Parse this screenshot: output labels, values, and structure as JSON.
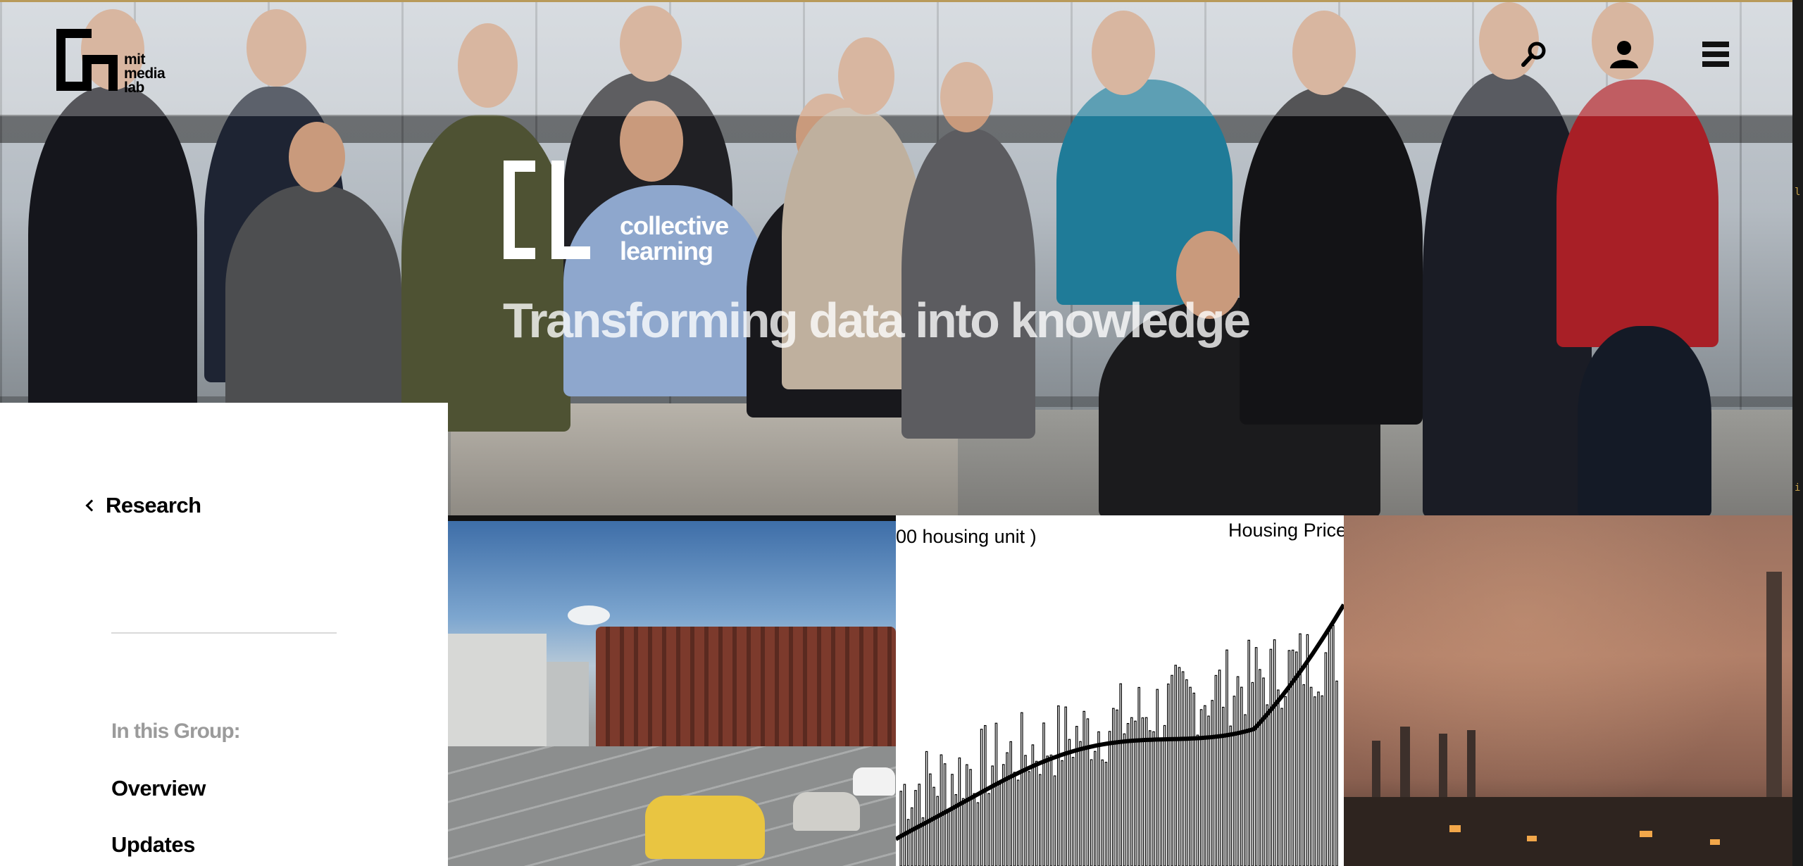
{
  "header": {
    "logo_line1": "mit",
    "logo_line2": "media",
    "logo_line3": "lab",
    "icons": [
      "search-icon",
      "user-icon",
      "menu-icon"
    ]
  },
  "hero": {
    "brand_line1": "collective",
    "brand_line2": "learning",
    "title": "Transforming data into knowledge"
  },
  "sidebar": {
    "back_label": "Research",
    "group_label": "In this Group:",
    "links": [
      "Overview",
      "Updates"
    ]
  },
  "tiles": {
    "chart_ylabel_fragment": "00 housing unit )",
    "chart_title_fragment": "Housing Price"
  },
  "colors": {
    "accent_text": "#000000",
    "muted_text": "#9b9b9b",
    "hero_title": "#ffffff"
  }
}
